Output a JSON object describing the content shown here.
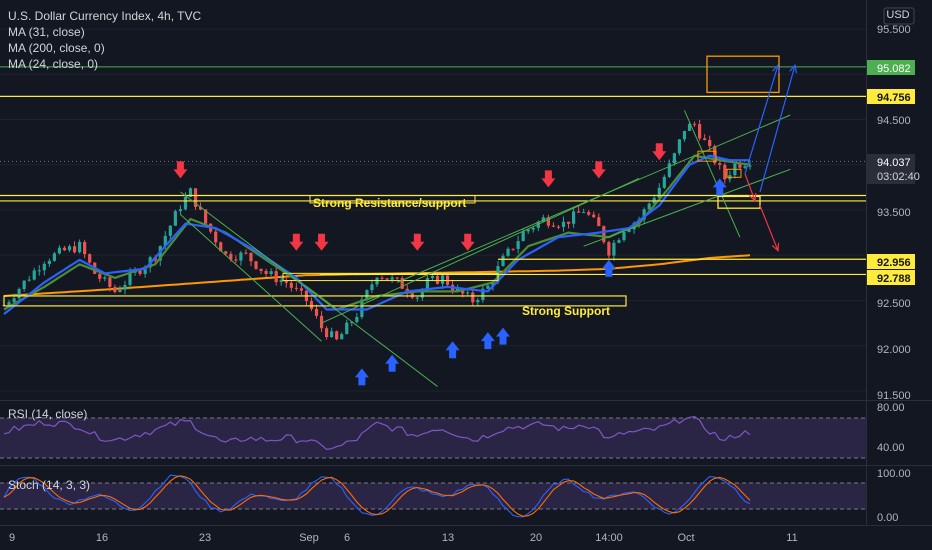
{
  "header": {
    "title": "U.S. Dollar Currency Index, 4h, TVC",
    "indicators": [
      "MA (31, close)",
      "MA (200, close, 0)",
      "MA (24, close, 0)"
    ]
  },
  "currency": "USD",
  "price_axis": {
    "ticks": [
      "95.500",
      "94.500",
      "93.500",
      "92.500",
      "92.000",
      "91.500"
    ],
    "labels": [
      {
        "value": 95.082,
        "text": "95.082",
        "bg": "#4caf50",
        "fg": "#ffffff"
      },
      {
        "value": 94.756,
        "text": "94.756",
        "bg": "#ffeb3b",
        "fg": "#131722"
      },
      {
        "value": 94.037,
        "text": "94.037",
        "sub": "03:02:40",
        "bg": "#2a2e39",
        "fg": "#ffffff"
      },
      {
        "value": 92.956,
        "text": "92.956",
        "bg": "#ffeb3b",
        "fg": "#131722"
      },
      {
        "value": 92.788,
        "text": "92.788",
        "bg": "#ffeb3b",
        "fg": "#131722"
      }
    ]
  },
  "time_axis": [
    "9",
    "16",
    "23",
    "Sep",
    "6",
    "13",
    "20",
    "14:00",
    "Oct",
    "11"
  ],
  "annotations": {
    "resistance": "Strong Resistance/support",
    "support": "Strong Support"
  },
  "rsi": {
    "label": "RSI (14, close)",
    "ticks": [
      "80.00",
      "40.00"
    ]
  },
  "stoch": {
    "label": "Stoch (14, 3, 3)",
    "ticks": [
      "100.00",
      "0.00"
    ]
  },
  "colors": {
    "background": "#131722",
    "up": "#26a69a",
    "down": "#ef5350",
    "ma31": "#2962ff",
    "ma200": "#ff9800",
    "ma24": "#4a8c3a",
    "level": "#ffeb3b",
    "channel": "#4caf50",
    "down_arrow": "#f23645",
    "up_arrow": "#2962ff",
    "rsi": "#7e57c2",
    "stoch_k": "#2962ff",
    "stoch_d": "#ff6d00"
  },
  "chart_data": {
    "type": "candlestick",
    "symbol": "U.S. Dollar Currency Index",
    "timeframe": "4h",
    "ylim": [
      91.4,
      95.6
    ],
    "price_path": [
      [
        0,
        92.45
      ],
      [
        4,
        92.7
      ],
      [
        8,
        92.95
      ],
      [
        12,
        93.05
      ],
      [
        15,
        93.1
      ],
      [
        18,
        92.8
      ],
      [
        22,
        92.6
      ],
      [
        26,
        92.8
      ],
      [
        30,
        93.0
      ],
      [
        35,
        93.55
      ],
      [
        37,
        93.7
      ],
      [
        40,
        93.35
      ],
      [
        44,
        93.0
      ],
      [
        48,
        93.0
      ],
      [
        52,
        92.8
      ],
      [
        56,
        92.7
      ],
      [
        60,
        92.5
      ],
      [
        63,
        92.2
      ],
      [
        66,
        92.05
      ],
      [
        70,
        92.35
      ],
      [
        74,
        92.8
      ],
      [
        78,
        92.7
      ],
      [
        82,
        92.55
      ],
      [
        84,
        92.7
      ],
      [
        87,
        92.75
      ],
      [
        90,
        92.6
      ],
      [
        93,
        92.5
      ],
      [
        96,
        92.65
      ],
      [
        99,
        92.95
      ],
      [
        103,
        93.25
      ],
      [
        107,
        93.4
      ],
      [
        111,
        93.35
      ],
      [
        115,
        93.5
      ],
      [
        118,
        93.3
      ],
      [
        120,
        93.05
      ],
      [
        123,
        93.3
      ],
      [
        126,
        93.4
      ],
      [
        130,
        93.75
      ],
      [
        133,
        94.1
      ],
      [
        135,
        94.4
      ],
      [
        137,
        94.45
      ],
      [
        139,
        94.25
      ],
      [
        141,
        94.05
      ],
      [
        143,
        93.85
      ],
      [
        145,
        94.0
      ],
      [
        148,
        94.05
      ]
    ],
    "ma31_path": [
      [
        0,
        92.35
      ],
      [
        8,
        92.7
      ],
      [
        15,
        92.95
      ],
      [
        20,
        92.8
      ],
      [
        28,
        92.85
      ],
      [
        36,
        93.35
      ],
      [
        42,
        93.3
      ],
      [
        50,
        93.05
      ],
      [
        58,
        92.75
      ],
      [
        64,
        92.4
      ],
      [
        72,
        92.4
      ],
      [
        80,
        92.6
      ],
      [
        88,
        92.65
      ],
      [
        96,
        92.6
      ],
      [
        102,
        92.95
      ],
      [
        110,
        93.2
      ],
      [
        118,
        93.25
      ],
      [
        124,
        93.3
      ],
      [
        130,
        93.55
      ],
      [
        136,
        94.0
      ],
      [
        140,
        94.1
      ],
      [
        144,
        94.05
      ],
      [
        148,
        94.05
      ]
    ],
    "ma24_path": [
      [
        0,
        92.4
      ],
      [
        8,
        92.65
      ],
      [
        15,
        92.9
      ],
      [
        22,
        92.75
      ],
      [
        30,
        92.9
      ],
      [
        37,
        93.4
      ],
      [
        44,
        93.25
      ],
      [
        52,
        92.95
      ],
      [
        60,
        92.65
      ],
      [
        66,
        92.4
      ],
      [
        74,
        92.55
      ],
      [
        82,
        92.6
      ],
      [
        90,
        92.6
      ],
      [
        97,
        92.7
      ],
      [
        104,
        93.1
      ],
      [
        112,
        93.25
      ],
      [
        120,
        93.2
      ],
      [
        126,
        93.35
      ],
      [
        132,
        93.75
      ],
      [
        137,
        94.1
      ],
      [
        142,
        94.05
      ],
      [
        148,
        94.0
      ]
    ],
    "ma200_path": [
      [
        0,
        92.55
      ],
      [
        20,
        92.62
      ],
      [
        40,
        92.7
      ],
      [
        60,
        92.78
      ],
      [
        80,
        92.8
      ],
      [
        100,
        92.82
      ],
      [
        110,
        92.83
      ],
      [
        120,
        92.85
      ],
      [
        130,
        92.9
      ],
      [
        140,
        92.97
      ],
      [
        148,
        93.0
      ]
    ],
    "levels": [
      95.082,
      94.756,
      93.66,
      93.6,
      92.956,
      92.788,
      92.5
    ],
    "resistance_zone": [
      93.6,
      93.66
    ],
    "support_zone": [
      92.45,
      92.55
    ],
    "down_arrow_signals": [
      [
        35,
        93.85
      ],
      [
        58,
        93.05
      ],
      [
        63,
        93.05
      ],
      [
        82,
        93.05
      ],
      [
        92,
        93.05
      ],
      [
        108,
        93.75
      ],
      [
        118,
        93.85
      ],
      [
        130,
        94.05
      ]
    ],
    "up_arrow_signals": [
      [
        71,
        91.75
      ],
      [
        77,
        91.9
      ],
      [
        89,
        92.05
      ],
      [
        96,
        92.15
      ],
      [
        99,
        92.2
      ],
      [
        120,
        92.95
      ],
      [
        142,
        93.85
      ]
    ],
    "rsi_levels": [
      70,
      30
    ],
    "rsi_ylim": [
      10,
      90
    ],
    "stoch_levels": [
      80,
      20
    ],
    "stoch_ylim": [
      -10,
      110
    ]
  }
}
